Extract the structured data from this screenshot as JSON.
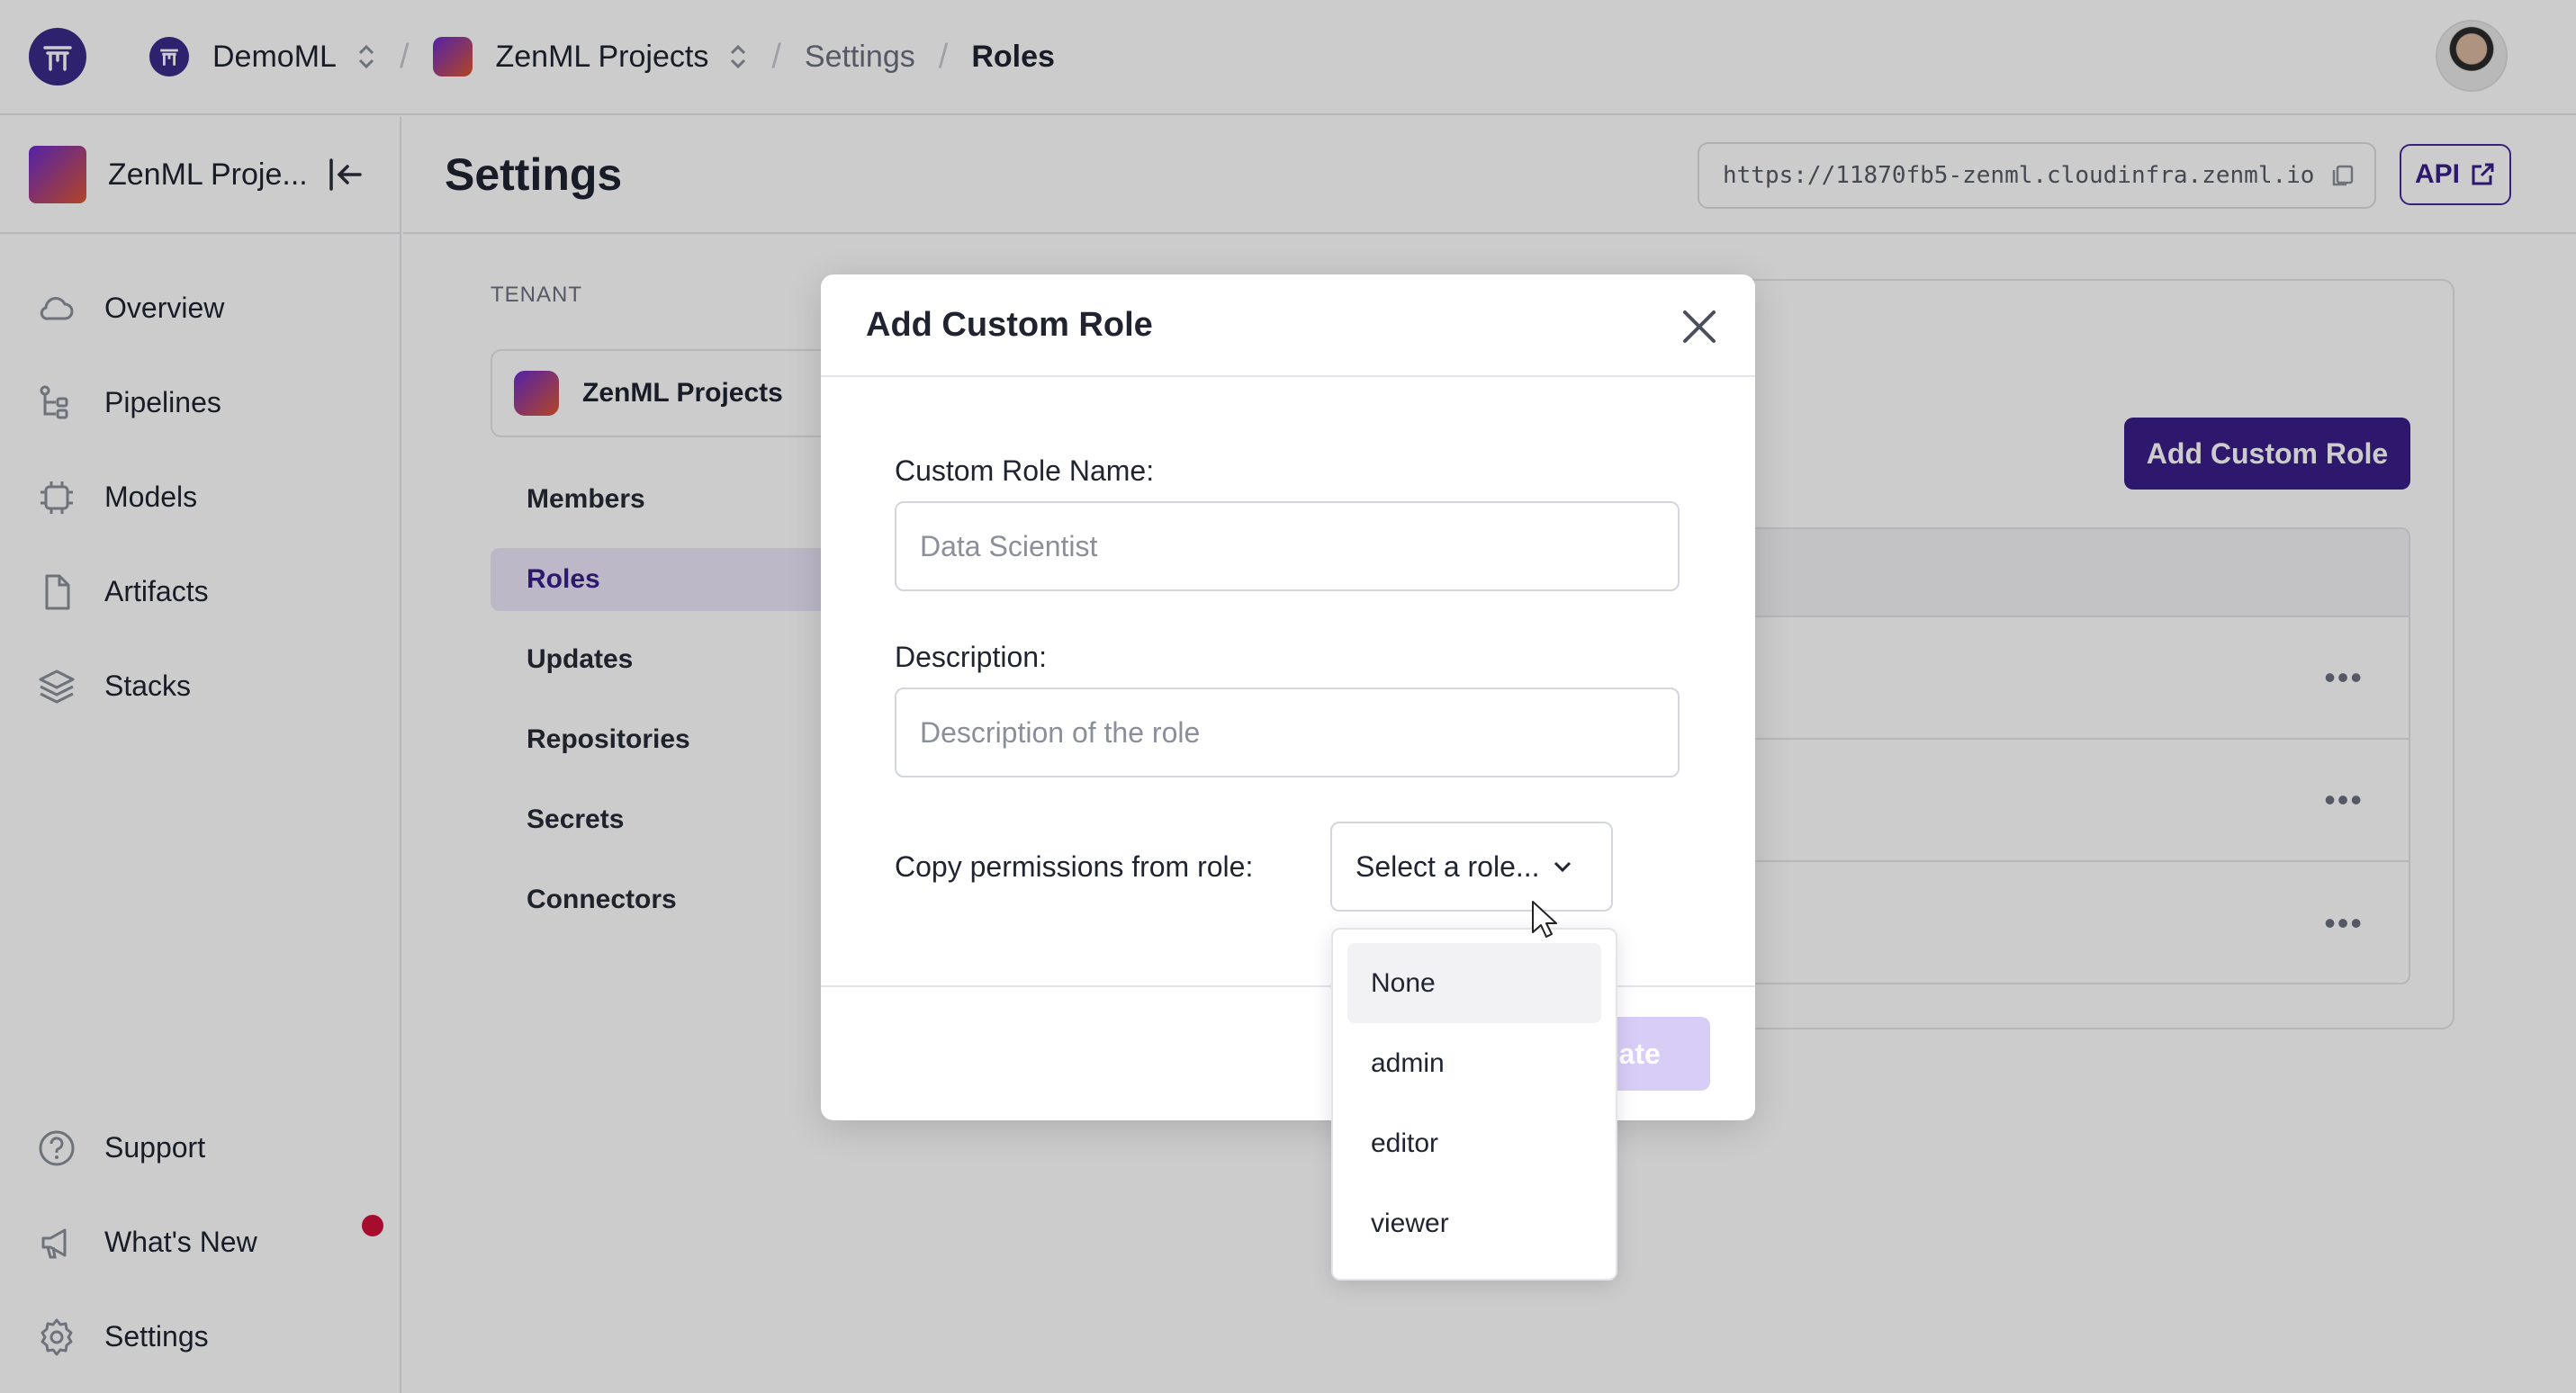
{
  "topbar": {
    "org_name": "DemoML",
    "project_name": "ZenML Projects",
    "breadcrumb_settings": "Settings",
    "breadcrumb_current": "Roles"
  },
  "sidebar": {
    "project_name": "ZenML Proje...",
    "items": [
      {
        "label": "Overview",
        "icon": "cloud-icon"
      },
      {
        "label": "Pipelines",
        "icon": "pipeline-icon"
      },
      {
        "label": "Models",
        "icon": "chip-icon"
      },
      {
        "label": "Artifacts",
        "icon": "file-icon"
      },
      {
        "label": "Stacks",
        "icon": "layers-icon"
      }
    ],
    "bottom_items": [
      {
        "label": "Support",
        "icon": "help-icon"
      },
      {
        "label": "What's New",
        "icon": "megaphone-icon"
      },
      {
        "label": "Settings",
        "icon": "gear-icon"
      }
    ]
  },
  "header": {
    "title": "Settings",
    "server_url": "https://11870fb5-zenml.cloudinfra.zenml.io",
    "api_label": "API"
  },
  "settings_nav": {
    "tenant_label": "TENANT",
    "tenant_name": "ZenML Projects",
    "items": [
      "Members",
      "Roles",
      "Updates",
      "Repositories",
      "Secrets",
      "Connectors"
    ],
    "active": "Roles"
  },
  "roles_panel": {
    "add_button": "Add Custom Role"
  },
  "modal": {
    "title": "Add Custom Role",
    "name_label": "Custom Role Name:",
    "name_placeholder": "Data Scientist",
    "description_label": "Description:",
    "description_placeholder": "Description of the role",
    "copy_label": "Copy permissions from role:",
    "select_value": "Select a role...",
    "create_label": "Create"
  },
  "dropdown": {
    "options": [
      "None",
      "admin",
      "editor",
      "viewer"
    ],
    "hovered": "None"
  },
  "colors": {
    "brand": "#3a1f8a",
    "active_bg": "#ebe6fb",
    "notification": "#d0103a"
  }
}
